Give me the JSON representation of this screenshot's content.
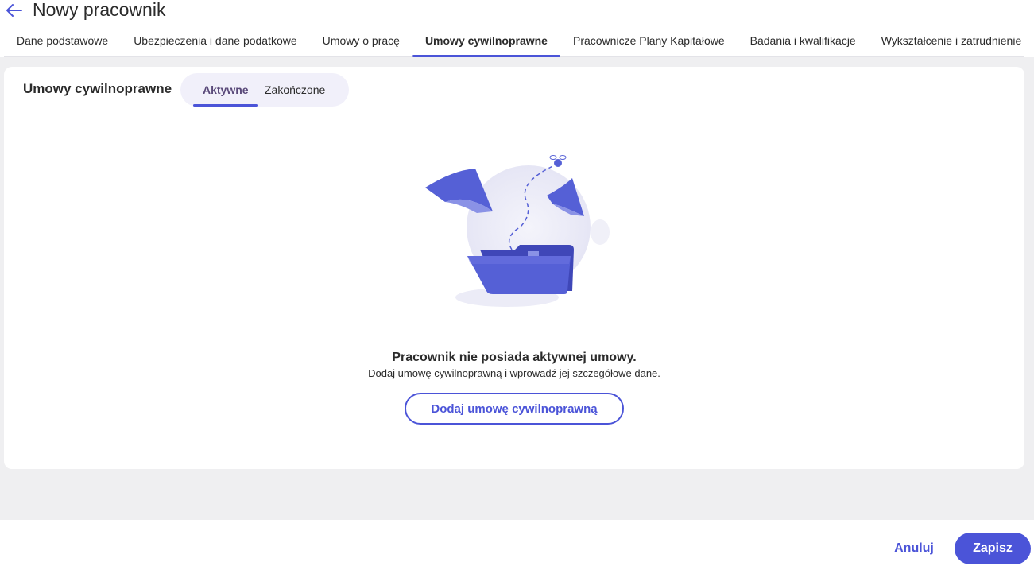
{
  "header": {
    "title": "Nowy pracownik",
    "back_icon": "arrow-left-icon"
  },
  "tabs": [
    {
      "label": "Dane podstawowe",
      "active": false
    },
    {
      "label": "Ubezpieczenia i dane podatkowe",
      "active": false
    },
    {
      "label": "Umowy o pracę",
      "active": false
    },
    {
      "label": "Umowy cywilnoprawne",
      "active": true
    },
    {
      "label": "Pracownicze Plany Kapitałowe",
      "active": false
    },
    {
      "label": "Badania i kwalifikacje",
      "active": false
    },
    {
      "label": "Wykształcenie i zatrudnienie",
      "active": false
    }
  ],
  "card": {
    "title": "Umowy cywilnoprawne",
    "subtabs": [
      {
        "label": "Aktywne",
        "active": true
      },
      {
        "label": "Zakończone",
        "active": false
      }
    ],
    "empty_state": {
      "title": "Pracownik nie posiada aktywnej umowy.",
      "subtitle": "Dodaj umowę cywilnoprawną i wprowadź jej szczegółowe dane.",
      "button_label": "Dodaj umowę cywilnoprawną",
      "illustration": "empty-folder-illustration"
    }
  },
  "footer": {
    "cancel_label": "Anuluj",
    "save_label": "Zapisz"
  },
  "colors": {
    "accent": "#4b54d8",
    "background_gray": "#efeff1",
    "pill_background": "#f1f0fa"
  }
}
